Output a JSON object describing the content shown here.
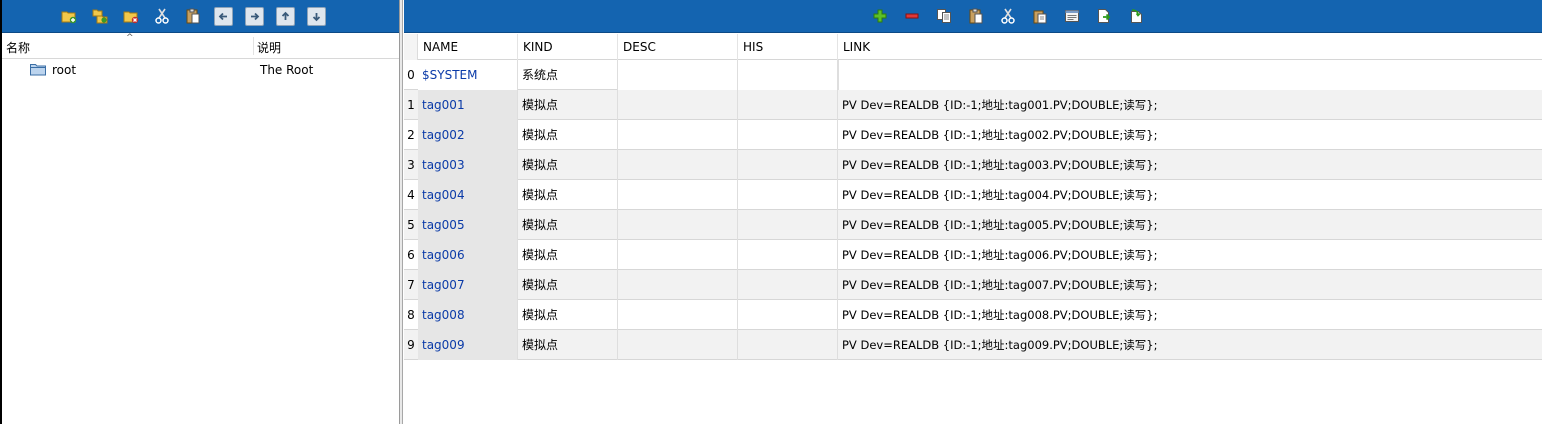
{
  "colors": {
    "toolbar_bg": "#1464b0",
    "link_text": "#0a3aa8",
    "name_cell_bg": "#e6e6e6"
  },
  "left_toolbar": {
    "icons": [
      "folder-new-icon",
      "folder-add-child-icon",
      "folder-delete-icon",
      "cut-icon",
      "paste-icon",
      "arrow-left-icon",
      "arrow-right-icon",
      "arrow-up-icon",
      "arrow-down-icon"
    ]
  },
  "tree": {
    "headers": {
      "name": "名称",
      "desc": "说明"
    },
    "sort_indicator": "^",
    "nodes": [
      {
        "label": "root",
        "desc": "The Root",
        "icon": "folder-icon"
      }
    ]
  },
  "right_toolbar": {
    "icons": [
      "add-icon",
      "remove-icon",
      "copy-icon",
      "paste-icon",
      "cut-icon",
      "paste-special-icon",
      "properties-icon",
      "export-icon",
      "import-icon"
    ]
  },
  "grid": {
    "columns": [
      "NAME",
      "KIND",
      "DESC",
      "HIS",
      "LINK"
    ],
    "rows": [
      {
        "index": "0",
        "name": "$SYSTEM",
        "kind": "系统点",
        "desc": "",
        "his": "",
        "link": ""
      },
      {
        "index": "1",
        "name": "tag001",
        "kind": "模拟点",
        "desc": "",
        "his": "",
        "link": "PV Dev=REALDB {ID:-1;地址:tag001.PV;DOUBLE;读写};"
      },
      {
        "index": "2",
        "name": "tag002",
        "kind": "模拟点",
        "desc": "",
        "his": "",
        "link": "PV Dev=REALDB {ID:-1;地址:tag002.PV;DOUBLE;读写};"
      },
      {
        "index": "3",
        "name": "tag003",
        "kind": "模拟点",
        "desc": "",
        "his": "",
        "link": "PV Dev=REALDB {ID:-1;地址:tag003.PV;DOUBLE;读写};"
      },
      {
        "index": "4",
        "name": "tag004",
        "kind": "模拟点",
        "desc": "",
        "his": "",
        "link": "PV Dev=REALDB {ID:-1;地址:tag004.PV;DOUBLE;读写};"
      },
      {
        "index": "5",
        "name": "tag005",
        "kind": "模拟点",
        "desc": "",
        "his": "",
        "link": "PV Dev=REALDB {ID:-1;地址:tag005.PV;DOUBLE;读写};"
      },
      {
        "index": "6",
        "name": "tag006",
        "kind": "模拟点",
        "desc": "",
        "his": "",
        "link": "PV Dev=REALDB {ID:-1;地址:tag006.PV;DOUBLE;读写};"
      },
      {
        "index": "7",
        "name": "tag007",
        "kind": "模拟点",
        "desc": "",
        "his": "",
        "link": "PV Dev=REALDB {ID:-1;地址:tag007.PV;DOUBLE;读写};"
      },
      {
        "index": "8",
        "name": "tag008",
        "kind": "模拟点",
        "desc": "",
        "his": "",
        "link": "PV Dev=REALDB {ID:-1;地址:tag008.PV;DOUBLE;读写};"
      },
      {
        "index": "9",
        "name": "tag009",
        "kind": "模拟点",
        "desc": "",
        "his": "",
        "link": "PV Dev=REALDB {ID:-1;地址:tag009.PV;DOUBLE;读写};"
      }
    ]
  }
}
